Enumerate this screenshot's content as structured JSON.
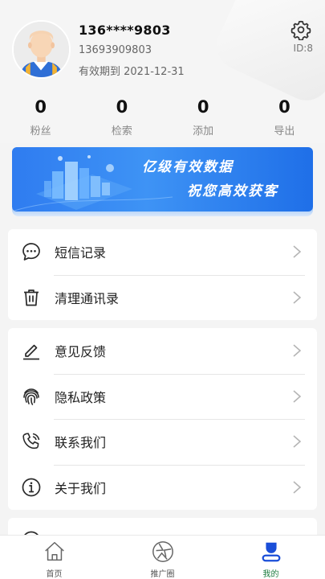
{
  "profile": {
    "name": "136****9803",
    "phone": "13693909803",
    "expiry": "有效期到 2021-12-31",
    "id_label": "ID:8"
  },
  "stats": [
    {
      "value": "0",
      "label": "粉丝"
    },
    {
      "value": "0",
      "label": "检索"
    },
    {
      "value": "0",
      "label": "添加"
    },
    {
      "value": "0",
      "label": "导出"
    }
  ],
  "banner": {
    "line1": "亿级有效数据",
    "line2": "祝您高效获客"
  },
  "menu_group1": [
    {
      "label": "短信记录",
      "icon": "chat-bubble-icon"
    },
    {
      "label": "清理通讯录",
      "icon": "trash-icon"
    }
  ],
  "menu_group2": [
    {
      "label": "意见反馈",
      "icon": "edit-pen-icon"
    },
    {
      "label": "隐私政策",
      "icon": "fingerprint-icon"
    },
    {
      "label": "联系我们",
      "icon": "phone-icon"
    },
    {
      "label": "关于我们",
      "icon": "info-icon"
    }
  ],
  "tabs": [
    {
      "label": "首页",
      "icon": "home-icon",
      "active": false
    },
    {
      "label": "推广圈",
      "icon": "aperture-icon",
      "active": false
    },
    {
      "label": "我的",
      "icon": "profile-icon",
      "active": true
    }
  ],
  "colors": {
    "active_tab": "#1b7b3e",
    "banner_blue": "#2f7cf0",
    "profile_icon_blue": "#1a4ed8"
  }
}
